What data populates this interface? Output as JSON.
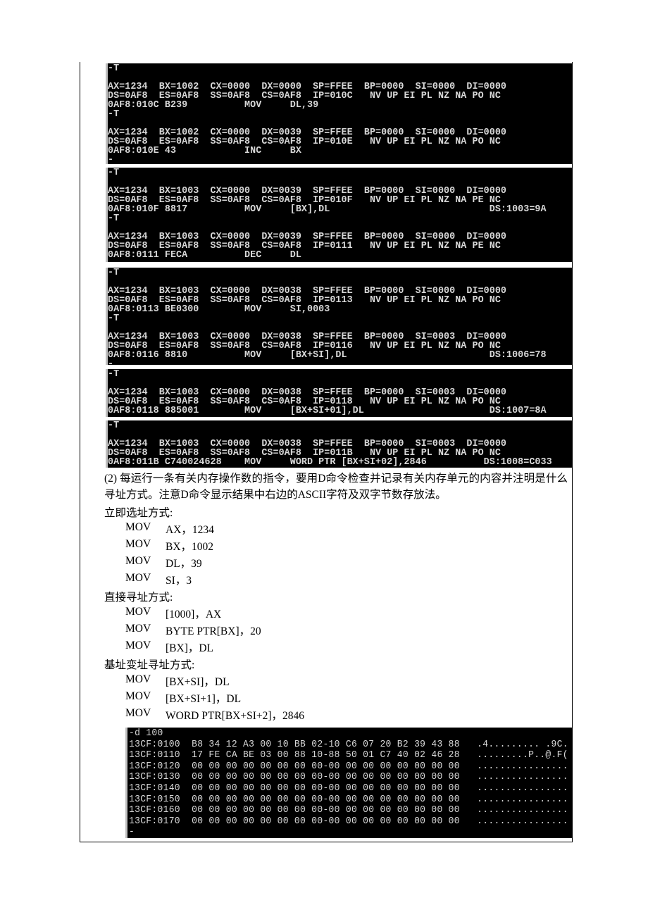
{
  "consoles": [
    {
      "lines": [
        "-T",
        "",
        "AX=1234  BX=1002  CX=0000  DX=0000  SP=FFEE  BP=0000  SI=0000  DI=0000",
        "DS=0AF8  ES=0AF8  SS=0AF8  CS=0AF8  IP=010C   NV UP EI PL NZ NA PO NC",
        "0AF8:010C B239          MOV     DL,39",
        "-T",
        "",
        "AX=1234  BX=1002  CX=0000  DX=0039  SP=FFEE  BP=0000  SI=0000  DI=0000",
        "DS=0AF8  ES=0AF8  SS=0AF8  CS=0AF8  IP=010E   NV UP EI PL NZ NA PO NC",
        "0AF8:010E 43            INC     BX",
        "-"
      ]
    },
    {
      "lines": [
        "-T",
        "",
        "AX=1234  BX=1003  CX=0000  DX=0039  SP=FFEE  BP=0000  SI=0000  DI=0000",
        "DS=0AF8  ES=0AF8  SS=0AF8  CS=0AF8  IP=010F   NV UP EI PL NZ NA PE NC",
        "0AF8:010F 8817          MOV     [BX],DL                            DS:1003=9A",
        "-T",
        "",
        "AX=1234  BX=1003  CX=0000  DX=0039  SP=FFEE  BP=0000  SI=0000  DI=0000",
        "DS=0AF8  ES=0AF8  SS=0AF8  CS=0AF8  IP=0111   NV UP EI PL NZ NA PE NC",
        "0AF8:0111 FECA          DEC     DL"
      ]
    },
    {
      "lines": [
        "-T",
        "",
        "AX=1234  BX=1003  CX=0000  DX=0038  SP=FFEE  BP=0000  SI=0000  DI=0000",
        "DS=0AF8  ES=0AF8  SS=0AF8  CS=0AF8  IP=0113   NV UP EI PL NZ NA PO NC",
        "0AF8:0113 BE0300        MOV     SI,0003",
        "-T",
        "",
        "AX=1234  BX=1003  CX=0000  DX=0038  SP=FFEE  BP=0000  SI=0003  DI=0000",
        "DS=0AF8  ES=0AF8  SS=0AF8  CS=0AF8  IP=0116   NV UP EI PL NZ NA PO NC",
        "0AF8:0116 8810          MOV     [BX+SI],DL                         DS:1006=78",
        "-"
      ]
    },
    {
      "lines": [
        "-T",
        "",
        "AX=1234  BX=1003  CX=0000  DX=0038  SP=FFEE  BP=0000  SI=0003  DI=0000",
        "DS=0AF8  ES=0AF8  SS=0AF8  CS=0AF8  IP=0118   NV UP EI PL NZ NA PO NC",
        "0AF8:0118 885001        MOV     [BX+SI+01],DL                      DS:1007=8A"
      ]
    },
    {
      "lines": [
        "-T",
        "",
        "AX=1234  BX=1003  CX=0000  DX=0038  SP=FFEE  BP=0000  SI=0003  DI=0000",
        "DS=0AF8  ES=0AF8  SS=0AF8  CS=0AF8  IP=011B   NV UP EI PL NZ NA PO NC",
        "0AF8:011B C740024628    MOV     WORD PTR [BX+SI+02],2846          DS:1008=C033"
      ]
    }
  ],
  "paragraph": "(2) 每运行一条有关内存操作数的指令，要用D命令检查并记录有关内存单元的内容并注明是什么寻址方式。注意D命令显示结果中右边的ASCII字符及双字节数存放法。",
  "sections": [
    {
      "label": "立即选址方式:",
      "items": [
        [
          "MOV",
          "AX，1234"
        ],
        [
          "MOV",
          "BX，1002"
        ],
        [
          "MOV",
          "DL，39"
        ],
        [
          "MOV",
          "SI，3"
        ]
      ]
    },
    {
      "label": "直接寻址方式:",
      "items": [
        [
          "MOV",
          "[1000]，AX"
        ],
        [
          "MOV",
          "BYTE PTR[BX]，20"
        ],
        [
          "MOV",
          "[BX]，DL"
        ]
      ]
    },
    {
      "label": "基址变址寻址方式:",
      "items": [
        [
          "MOV",
          "[BX+SI]，DL"
        ],
        [
          "MOV",
          "[BX+SI+1]，DL"
        ],
        [
          "MOV",
          "WORD PTR[BX+SI+2]，2846"
        ]
      ]
    }
  ],
  "dump": {
    "lines": [
      "-d 100",
      "13CF:0100  B8 34 12 A3 00 10 BB 02-10 C6 07 20 B2 39 43 88   .4......... .9C.",
      "13CF:0110  17 FE CA BE 03 00 88 10-88 50 01 C7 40 02 46 28   .........P..@.F(",
      "13CF:0120  00 00 00 00 00 00 00 00-00 00 00 00 00 00 00 00   ................",
      "13CF:0130  00 00 00 00 00 00 00 00-00 00 00 00 00 00 00 00   ................",
      "13CF:0140  00 00 00 00 00 00 00 00-00 00 00 00 00 00 00 00   ................",
      "13CF:0150  00 00 00 00 00 00 00 00-00 00 00 00 00 00 00 00   ................",
      "13CF:0160  00 00 00 00 00 00 00 00-00 00 00 00 00 00 00 00   ................",
      "13CF:0170  00 00 00 00 00 00 00 00-00 00 00 00 00 00 00 00   ................",
      "-"
    ]
  }
}
